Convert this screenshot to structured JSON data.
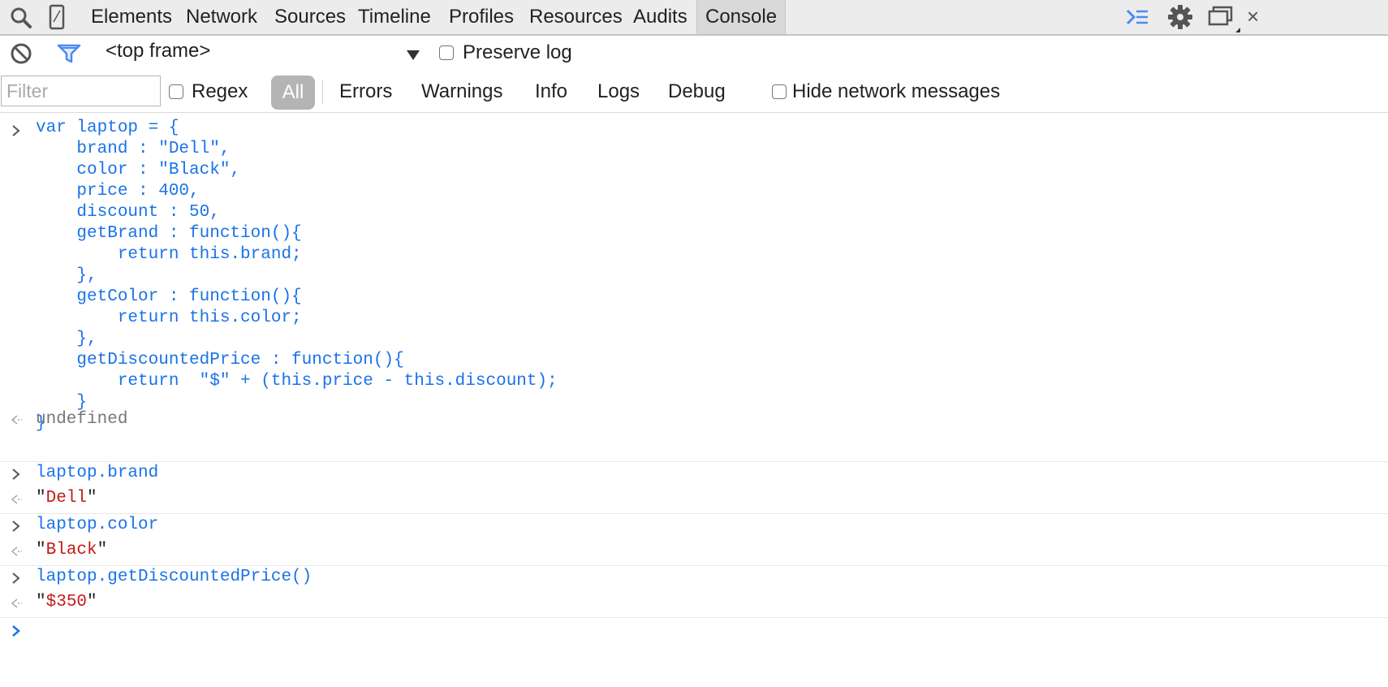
{
  "tabs": [
    "Elements",
    "Network",
    "Sources",
    "Timeline",
    "Profiles",
    "Resources",
    "Audits",
    "Console"
  ],
  "active_tab": "Console",
  "toolbar": {
    "frame_select": "<top frame>",
    "preserve_log": "Preserve log"
  },
  "filter_bar": {
    "placeholder": "Filter",
    "regex": "Regex",
    "levels": [
      "All",
      "Errors",
      "Warnings",
      "Info",
      "Logs",
      "Debug"
    ],
    "hide_network": "Hide network messages"
  },
  "console": {
    "block_code": "var laptop = {\n    brand : \"Dell\",\n    color : \"Black\",\n    price : 400,\n    discount : 50,\n    getBrand : function(){\n        return this.brand;\n    },\n    getColor : function(){\n        return this.color;\n    },\n    getDiscountedPrice : function(){\n        return  \"$\" + (this.price - this.discount);\n    }\n}",
    "block_result": "undefined",
    "entries": [
      {
        "input": "laptop.brand",
        "output": "Dell"
      },
      {
        "input": "laptop.color",
        "output": "Black"
      },
      {
        "input": "laptop.getDiscountedPrice()",
        "output": "$350"
      }
    ]
  },
  "colors": {
    "command": "#1a73e8",
    "string": "#c41a16",
    "result": "#777777"
  }
}
